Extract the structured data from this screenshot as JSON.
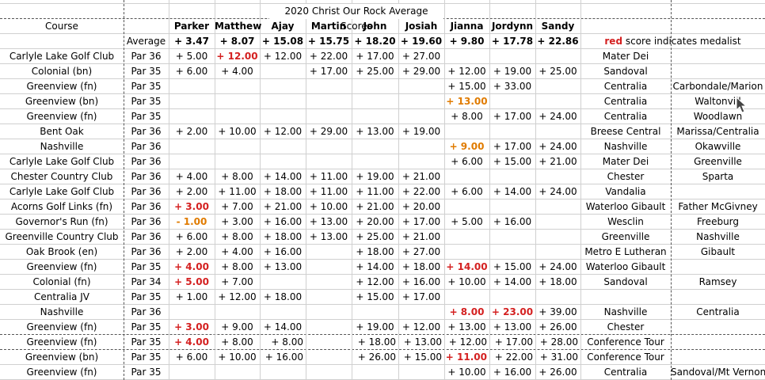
{
  "sheet_title": "2020 Christ Our Rock Average Scores",
  "headers": {
    "course": "Course",
    "players": [
      "Parker",
      "Matthew",
      "Ajay",
      "Martin",
      "John",
      "Josiah",
      "Jianna",
      "Jordynn",
      "Sandy"
    ]
  },
  "averages": {
    "label": "Average",
    "values": [
      "+ 3.47",
      "+ 8.07",
      "+ 15.08",
      "+ 15.75",
      "+ 18.20",
      "+ 19.60",
      "+ 9.80",
      "+ 17.78",
      "+ 22.86"
    ]
  },
  "legend": {
    "red_word": "red",
    "rest": " score indicates medalist"
  },
  "colors": {
    "medalist_red": "#d42020",
    "orange": "#e07b00",
    "grid": "#d0d0d0"
  },
  "rows": [
    {
      "course": "Carlyle Lake Golf Club",
      "par": "Par 36",
      "scores": [
        "+ 5.00",
        "+ 12.00",
        "+ 12.00",
        "+ 22.00",
        "+ 17.00",
        "+ 27.00",
        "",
        "",
        ""
      ],
      "opponent": "Mater Dei",
      "extra": ""
    },
    {
      "course": "Colonial (bn)",
      "par": "Par 35",
      "scores": [
        "+ 6.00",
        "+ 4.00",
        "",
        "+ 17.00",
        "+ 25.00",
        "+ 29.00",
        "+ 12.00",
        "+ 19.00",
        "+ 25.00"
      ],
      "opponent": "Sandoval",
      "extra": ""
    },
    {
      "course": "Greenview (fn)",
      "par": "Par 35",
      "scores": [
        "",
        "",
        "",
        "",
        "",
        "",
        "+ 15.00",
        "+ 33.00",
        ""
      ],
      "opponent": "Centralia",
      "extra": "Carbondale/Marion"
    },
    {
      "course": "Greenview (bn)",
      "par": "Par 35",
      "scores": [
        "",
        "",
        "",
        "",
        "",
        "",
        "+ 13.00",
        "",
        ""
      ],
      "opponent": "Centralia",
      "extra": "Waltonvill"
    },
    {
      "course": "Greenview (fn)",
      "par": "Par 35",
      "scores": [
        "",
        "",
        "",
        "",
        "",
        "",
        "+ 8.00",
        "+ 17.00",
        "+ 24.00"
      ],
      "opponent": "Centralia",
      "extra": "Woodlawn"
    },
    {
      "course": "Bent Oak",
      "par": "Par 36",
      "scores": [
        "+ 2.00",
        "+ 10.00",
        "+ 12.00",
        "+ 29.00",
        "+ 13.00",
        "+ 19.00",
        "",
        "",
        ""
      ],
      "opponent": "Breese Central",
      "extra": "Marissa/Centralia"
    },
    {
      "course": "Nashville",
      "par": "Par 36",
      "scores": [
        "",
        "",
        "",
        "",
        "",
        "",
        "+ 9.00",
        "+ 17.00",
        "+ 24.00"
      ],
      "opponent": "Nashville",
      "extra": "Okawville"
    },
    {
      "course": "Carlyle Lake Golf Club",
      "par": "Par 36",
      "scores": [
        "",
        "",
        "",
        "",
        "",
        "",
        "+ 6.00",
        "+ 15.00",
        "+ 21.00"
      ],
      "opponent": "Mater Dei",
      "extra": "Greenville"
    },
    {
      "course": "Chester Country Club",
      "par": "Par 36",
      "scores": [
        "+ 4.00",
        "+ 8.00",
        "+ 14.00",
        "+ 11.00",
        "+ 19.00",
        "+ 21.00",
        "",
        "",
        ""
      ],
      "opponent": "Chester",
      "extra": "Sparta"
    },
    {
      "course": "Carlyle Lake Golf Club",
      "par": "Par 36",
      "scores": [
        "+ 2.00",
        "+ 11.00",
        "+ 18.00",
        "+ 11.00",
        "+ 11.00",
        "+ 22.00",
        "+ 6.00",
        "+ 14.00",
        "+ 24.00"
      ],
      "opponent": "Vandalia",
      "extra": ""
    },
    {
      "course": "Acorns Golf Links (fn)",
      "par": "Par 36",
      "scores": [
        "+ 3.00",
        "+ 7.00",
        "+ 21.00",
        "+ 10.00",
        "+ 21.00",
        "+ 20.00",
        "",
        "",
        ""
      ],
      "opponent": "Waterloo Gibault",
      "extra": "Father McGivney"
    },
    {
      "course": "Governor's Run (fn)",
      "par": "Par 36",
      "scores": [
        "- 1.00",
        "+ 3.00",
        "+ 16.00",
        "+ 13.00",
        "+ 20.00",
        "+ 17.00",
        "+ 5.00",
        "+ 16.00",
        ""
      ],
      "opponent": "Wesclin",
      "extra": "Freeburg"
    },
    {
      "course": "Greenville Country Club",
      "par": "Par 36",
      "scores": [
        "+ 6.00",
        "+ 8.00",
        "+ 18.00",
        "+ 13.00",
        "+ 25.00",
        "+ 21.00",
        "",
        "",
        ""
      ],
      "opponent": "Greenville",
      "extra": "Nashville"
    },
    {
      "course": "Oak Brook (en)",
      "par": "Par 36",
      "scores": [
        "+ 2.00",
        "+ 4.00",
        "+ 16.00",
        "",
        "+ 18.00",
        "+ 27.00",
        "",
        "",
        ""
      ],
      "opponent": "Metro E Lutheran",
      "extra": "Gibault"
    },
    {
      "course": "Greenview (fn)",
      "par": "Par 35",
      "scores": [
        "+ 4.00",
        "+ 8.00",
        "+ 13.00",
        "",
        "+ 14.00",
        "+ 18.00",
        "+ 14.00",
        "+ 15.00",
        "+ 24.00"
      ],
      "opponent": "Waterloo Gibault",
      "extra": ""
    },
    {
      "course": "Colonial (fn)",
      "par": "Par 34",
      "scores": [
        "+ 5.00",
        "+ 7.00",
        "",
        "",
        "+ 12.00",
        "+ 16.00",
        "+ 10.00",
        "+ 14.00",
        "+ 18.00"
      ],
      "opponent": "Sandoval",
      "extra": "Ramsey"
    },
    {
      "course": "Centralia JV",
      "par": "Par 35",
      "scores": [
        "+ 1.00",
        "+ 12.00",
        "+ 18.00",
        "",
        "+ 15.00",
        "+ 17.00",
        "",
        "",
        ""
      ],
      "opponent": "",
      "extra": ""
    },
    {
      "course": "Nashville",
      "par": "Par 36",
      "scores": [
        "",
        "",
        "",
        "",
        "",
        "",
        "+ 8.00",
        "+ 23.00",
        "+ 39.00"
      ],
      "opponent": "Nashville",
      "extra": "Centralia"
    },
    {
      "course": "Greenview (fn)",
      "par": "Par 35",
      "scores": [
        "+ 3.00",
        "+ 9.00",
        "+ 14.00",
        "",
        "+ 19.00",
        "+ 12.00",
        "+ 13.00",
        "+ 13.00",
        "+ 26.00"
      ],
      "opponent": "Chester",
      "extra": ""
    },
    {
      "course": "Greenview (fn)",
      "par": "Par 35",
      "scores": [
        "+ 4.00",
        "+ 8.00",
        "+ 8.00",
        "",
        "+ 18.00",
        "+ 13.00",
        "+ 12.00",
        "+ 17.00",
        "+ 28.00"
      ],
      "opponent": "Conference Tour",
      "extra": ""
    },
    {
      "course": "Greenview (bn)",
      "par": "Par 35",
      "scores": [
        "+ 6.00",
        "+ 10.00",
        "+ 16.00",
        "",
        "+ 26.00",
        "+ 15.00",
        "+ 11.00",
        "+ 22.00",
        "+ 31.00"
      ],
      "opponent": "Conference Tour",
      "extra": ""
    },
    {
      "course": "Greenview (fn)",
      "par": "Par 35",
      "scores": [
        "",
        "",
        "",
        "",
        "",
        "",
        "+ 10.00",
        "+ 16.00",
        "+ 26.00"
      ],
      "opponent": "Centralia",
      "extra": "Sandoval/Mt Vernon"
    }
  ]
}
